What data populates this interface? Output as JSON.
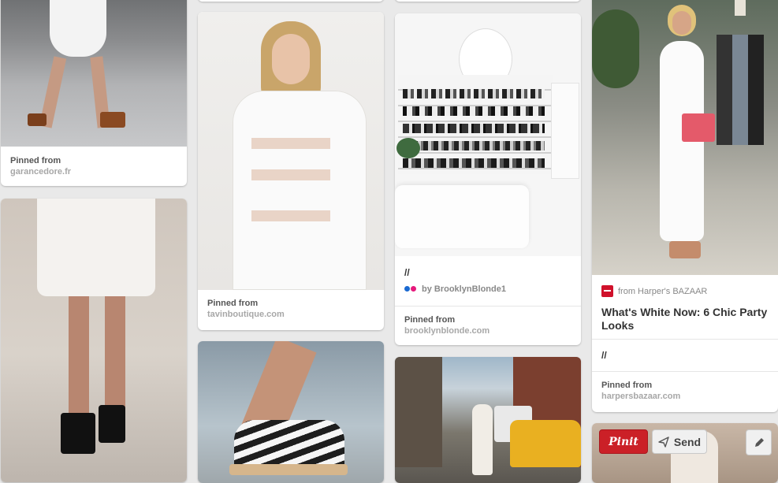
{
  "pins": [
    {
      "id": "c1a",
      "pinned_label": "Pinned from",
      "source": "garancedore.fr"
    },
    {
      "id": "c1b"
    },
    {
      "id": "c2a"
    },
    {
      "id": "c2b",
      "pinned_label": "Pinned from",
      "source": "tavinboutique.com"
    },
    {
      "id": "c2c"
    },
    {
      "id": "c3a"
    },
    {
      "id": "c3b",
      "description": "//",
      "by": "by BrooklynBlonde1",
      "pinned_label": "Pinned from",
      "source": "brooklynblonde.com"
    },
    {
      "id": "c3c"
    },
    {
      "id": "c4a",
      "from": "from Harper's BAZAAR",
      "title": "What's White Now: 6 Chic Party Looks",
      "description": "//",
      "pinned_label": "Pinned from",
      "source": "harpersbazaar.com"
    },
    {
      "id": "c4b"
    }
  ],
  "overlay": {
    "pinit_label": "Pinit",
    "send_label": "Send"
  },
  "icons": {
    "send": "paper-plane-icon",
    "edit": "pencil-icon",
    "brand": "harpers-bazaar-logo",
    "user": "flickr-dots-icon"
  },
  "colors": {
    "pinit_red": "#cb2027",
    "page_bg": "#e9e9e9"
  }
}
